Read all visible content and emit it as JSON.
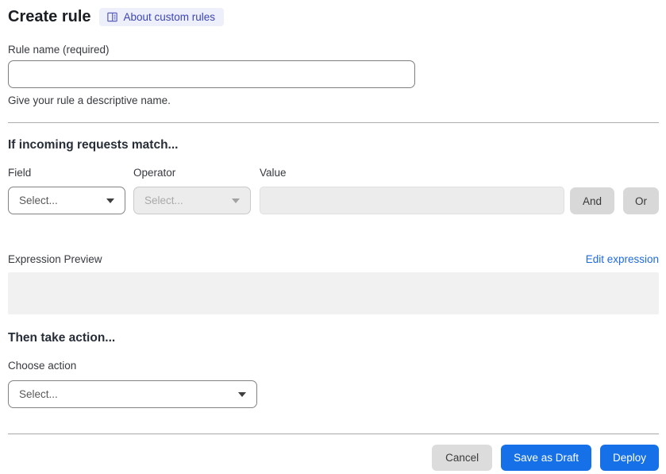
{
  "header": {
    "title": "Create rule",
    "about_link": "About custom rules"
  },
  "rule_name": {
    "label": "Rule name (required)",
    "value": "",
    "help": "Give your rule a descriptive name."
  },
  "match_section": {
    "heading": "If incoming requests match...",
    "field": {
      "label": "Field",
      "value": "Select..."
    },
    "operator": {
      "label": "Operator",
      "value": "Select..."
    },
    "value": {
      "label": "Value",
      "value": ""
    },
    "and_button": "And",
    "or_button": "Or",
    "expression_preview_label": "Expression Preview",
    "edit_expression_link": "Edit expression",
    "expression_value": ""
  },
  "action_section": {
    "heading": "Then take action...",
    "choose_action_label": "Choose action",
    "action_value": "Select..."
  },
  "footer": {
    "cancel": "Cancel",
    "save_draft": "Save as Draft",
    "deploy": "Deploy"
  },
  "icons": {
    "badge_icon": "book-icon",
    "select_icon": "chevron-down-icon"
  },
  "colors": {
    "primary_blue": "#1671e8",
    "link_blue": "#1f6ae0",
    "badge_bg": "#edeffb",
    "badge_text": "#3d45b5",
    "disabled_bg": "#ececec",
    "chip_gray": "#d8d8d8",
    "preview_bg": "#f1f1f2"
  }
}
